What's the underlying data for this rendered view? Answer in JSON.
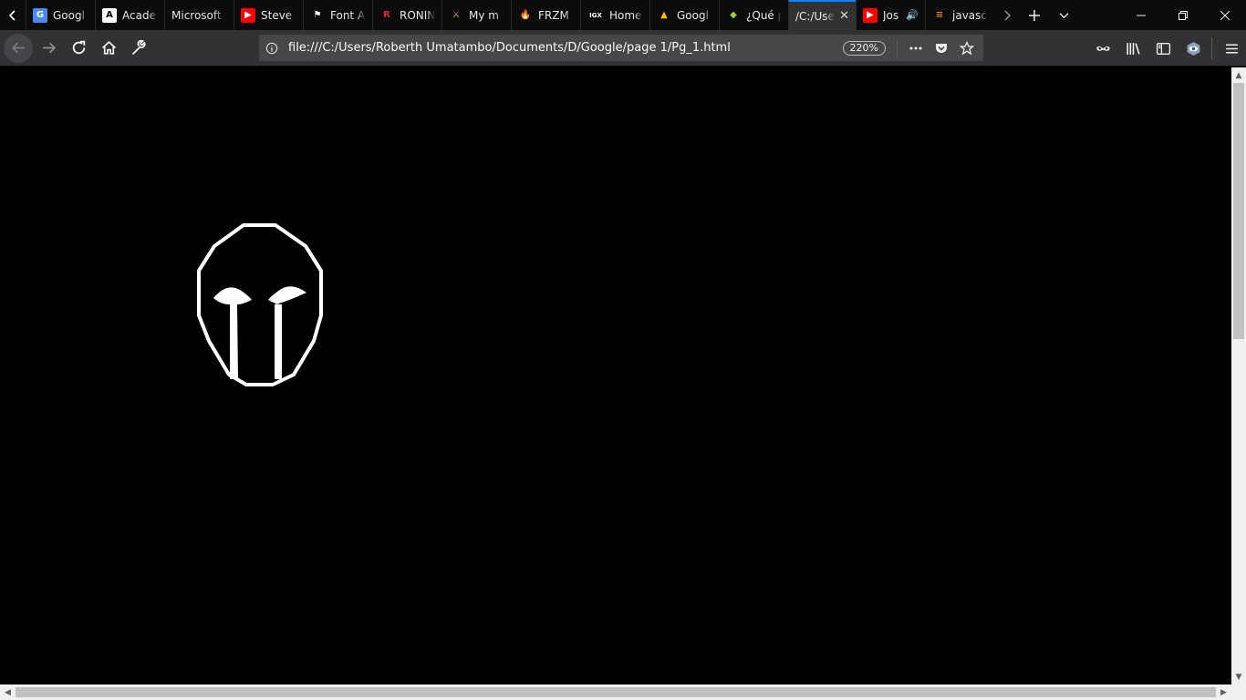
{
  "browser": {
    "tabs": [
      {
        "label": "Googl",
        "icon": "google-translate-icon",
        "fav": "G",
        "fav_bg": "#4a8af4",
        "fav_fg": "#ffffff"
      },
      {
        "label": "Acade",
        "icon": "academia-icon",
        "fav": "A",
        "fav_bg": "#ffffff",
        "fav_fg": "#000000"
      },
      {
        "label": "Microsoft",
        "icon": "",
        "fav": "",
        "fav_bg": "transparent",
        "fav_fg": "#ffffff"
      },
      {
        "label": "Steve /",
        "icon": "youtube-icon",
        "fav": "▶",
        "fav_bg": "#ff0000",
        "fav_fg": "#ffffff"
      },
      {
        "label": "Font A",
        "icon": "font-awesome-flag-icon",
        "fav": "⚑",
        "fav_bg": "transparent",
        "fav_fg": "#ffffff"
      },
      {
        "label": "RONIN",
        "icon": "ronin-icon",
        "fav": "R",
        "fav_bg": "transparent",
        "fav_fg": "#e0263a"
      },
      {
        "label": "My m",
        "icon": "sword-icon",
        "fav": "⚔",
        "fav_bg": "transparent",
        "fav_fg": "#c8a060"
      },
      {
        "label": "FRZM",
        "icon": "fire-icon",
        "fav": "🔥",
        "fav_bg": "transparent",
        "fav_fg": "#ffa020"
      },
      {
        "label": "Home",
        "icon": "igx-icon",
        "fav": "IGX",
        "fav_bg": "transparent",
        "fav_fg": "#ffffff"
      },
      {
        "label": "Googl",
        "icon": "google-drive-icon",
        "fav": "▲",
        "fav_bg": "transparent",
        "fav_fg": "#fbbc04"
      },
      {
        "label": "¿Qué p",
        "icon": "diamond-icon",
        "fav": "◆",
        "fav_bg": "transparent",
        "fav_fg": "#9bd23c"
      },
      {
        "label": "/C:/Use",
        "icon": "",
        "fav": "",
        "fav_bg": "transparent",
        "fav_fg": "#ffffff",
        "active": true
      },
      {
        "label": "Jos",
        "icon": "youtube-icon",
        "fav": "▶",
        "fav_bg": "#ff0000",
        "fav_fg": "#ffffff",
        "audio": true
      },
      {
        "label": "javasc",
        "icon": "stackoverflow-icon",
        "fav": "≡",
        "fav_bg": "transparent",
        "fav_fg": "#f48024"
      }
    ],
    "url": "file:///C:/Users/Roberth Umatambo/Documents/D/Google/page 1/Pg_1.html",
    "zoom": "220%"
  },
  "page": {
    "background": "#000000",
    "logo": "mask-logo",
    "logo_color": "#ffffff"
  }
}
